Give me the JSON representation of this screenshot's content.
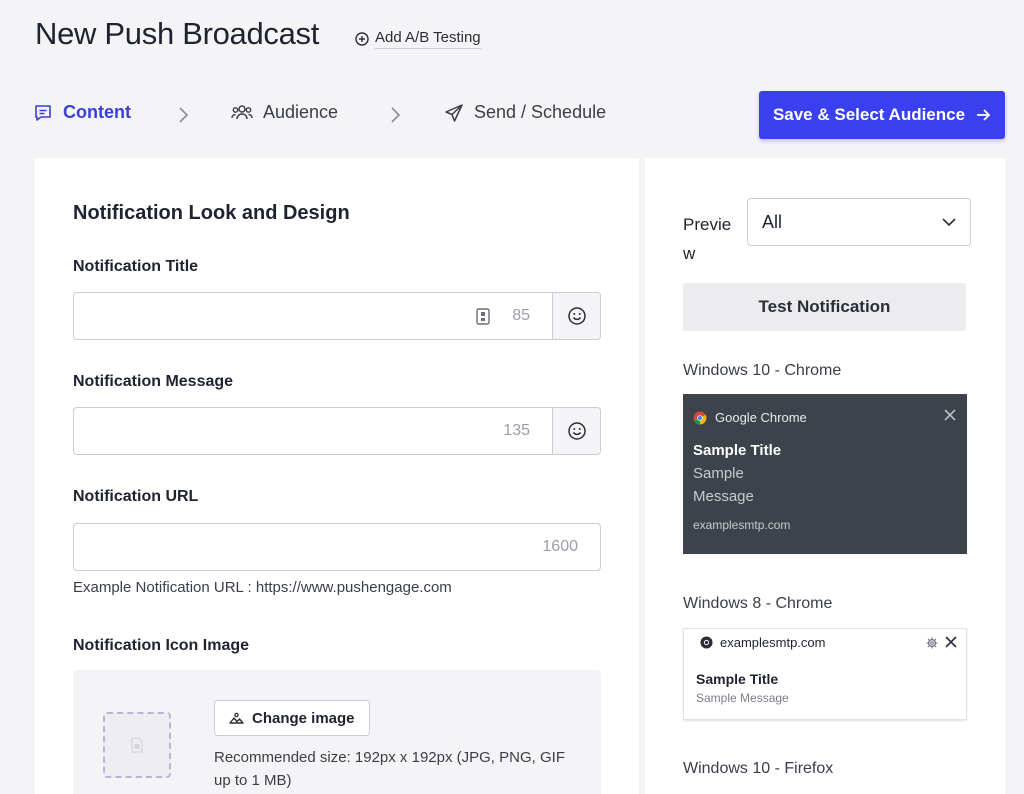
{
  "header": {
    "title": "New Push Broadcast",
    "ab_testing_label": "Add A/B Testing"
  },
  "steps": [
    {
      "label": "Content",
      "icon": "message-square-icon",
      "active": true
    },
    {
      "label": "Audience",
      "icon": "users-icon",
      "active": false
    },
    {
      "label": "Send / Schedule",
      "icon": "send-icon",
      "active": false
    }
  ],
  "save_button": {
    "label": "Save & Select Audience"
  },
  "form": {
    "section_title": "Notification Look and Design",
    "title_field": {
      "label": "Notification Title",
      "value": "",
      "counter": "85"
    },
    "message_field": {
      "label": "Notification Message",
      "value": "",
      "counter": "135"
    },
    "url_field": {
      "label": "Notification URL",
      "value": "",
      "counter": "1600",
      "helper": "Example Notification URL : https://www.pushengage.com"
    },
    "icon_image": {
      "label": "Notification Icon Image",
      "change_label": "Change image",
      "recommendation": "Recommended size: 192px x 192px (JPG, PNG, GIF up to 1 MB)"
    }
  },
  "preview": {
    "label": "Preview",
    "select_value": "All",
    "test_button": "Test Notification",
    "win10_chrome": {
      "os_label": "Windows 10 - Chrome",
      "browser": "Google Chrome",
      "title": "Sample Title",
      "message": "Sample Message",
      "domain": "examplesmtp.com"
    },
    "win8_chrome": {
      "os_label": "Windows 8 - Chrome",
      "domain": "examplesmtp.com",
      "title": "Sample Title",
      "message": "Sample Message"
    },
    "win10_firefox": {
      "os_label": "Windows 10 - Firefox"
    }
  },
  "colors": {
    "accent": "#3a3ff0",
    "active_step": "#3b3fd8",
    "win10_card": "#3c434a"
  }
}
